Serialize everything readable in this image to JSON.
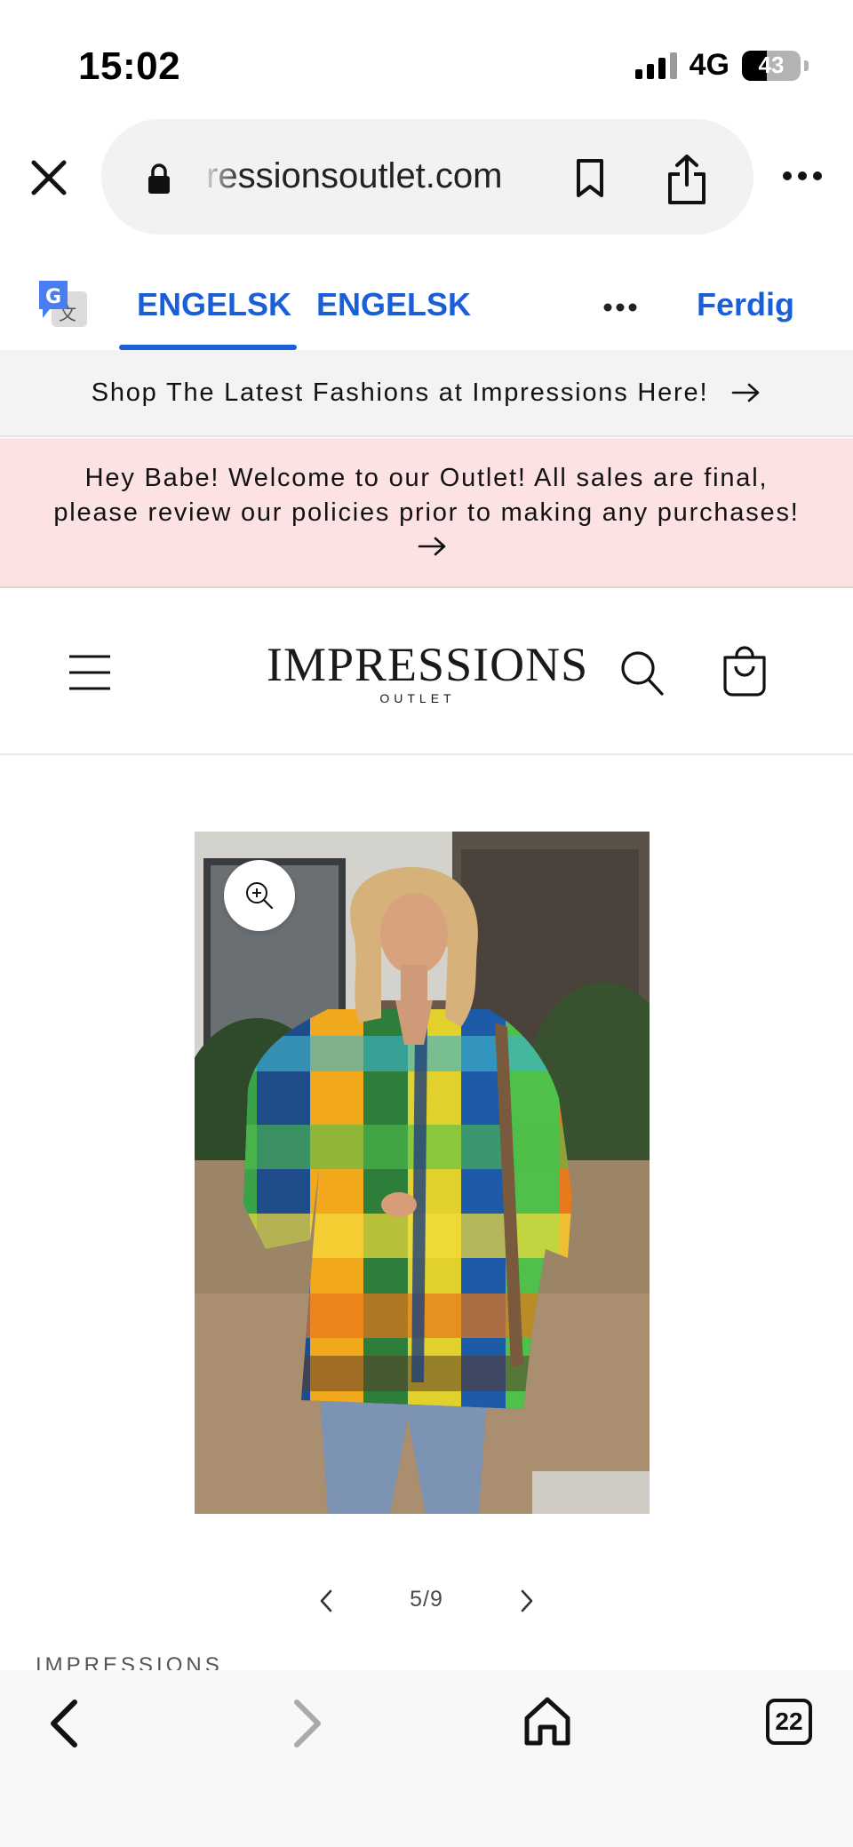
{
  "status_bar": {
    "time": "15:02",
    "network": "4G",
    "battery": "43",
    "battery_level": 0.43
  },
  "browser": {
    "url": "ressionsoutlet.com",
    "icons": [
      "close-icon",
      "lock-icon",
      "bookmark-icon",
      "share-icon",
      "more-icon"
    ]
  },
  "translate_bar": {
    "tab_1": "ENGELSK",
    "tab_2": "ENGELSK",
    "done": "Ferdig",
    "accent_color": "#1a5fd6"
  },
  "announcements": {
    "shop_latest": "Shop The Latest Fashions at Impressions Here!",
    "welcome": "Hey Babe! Welcome to our Outlet! All sales are final, please review our policies prior to making any purchases!",
    "welcome_bg": "#fde2e4"
  },
  "header": {
    "logo_main": "IMPRESSIONS",
    "logo_sub": "OUTLET",
    "icons": [
      "menu-icon",
      "search-icon",
      "cart-icon"
    ]
  },
  "product": {
    "slide_counter": "5/9",
    "vendor": "IMPRESSIONS"
  },
  "bottom_toolbar": {
    "tab_count": "22",
    "icons": [
      "back-icon",
      "forward-icon",
      "home-icon",
      "tabs-icon"
    ]
  }
}
